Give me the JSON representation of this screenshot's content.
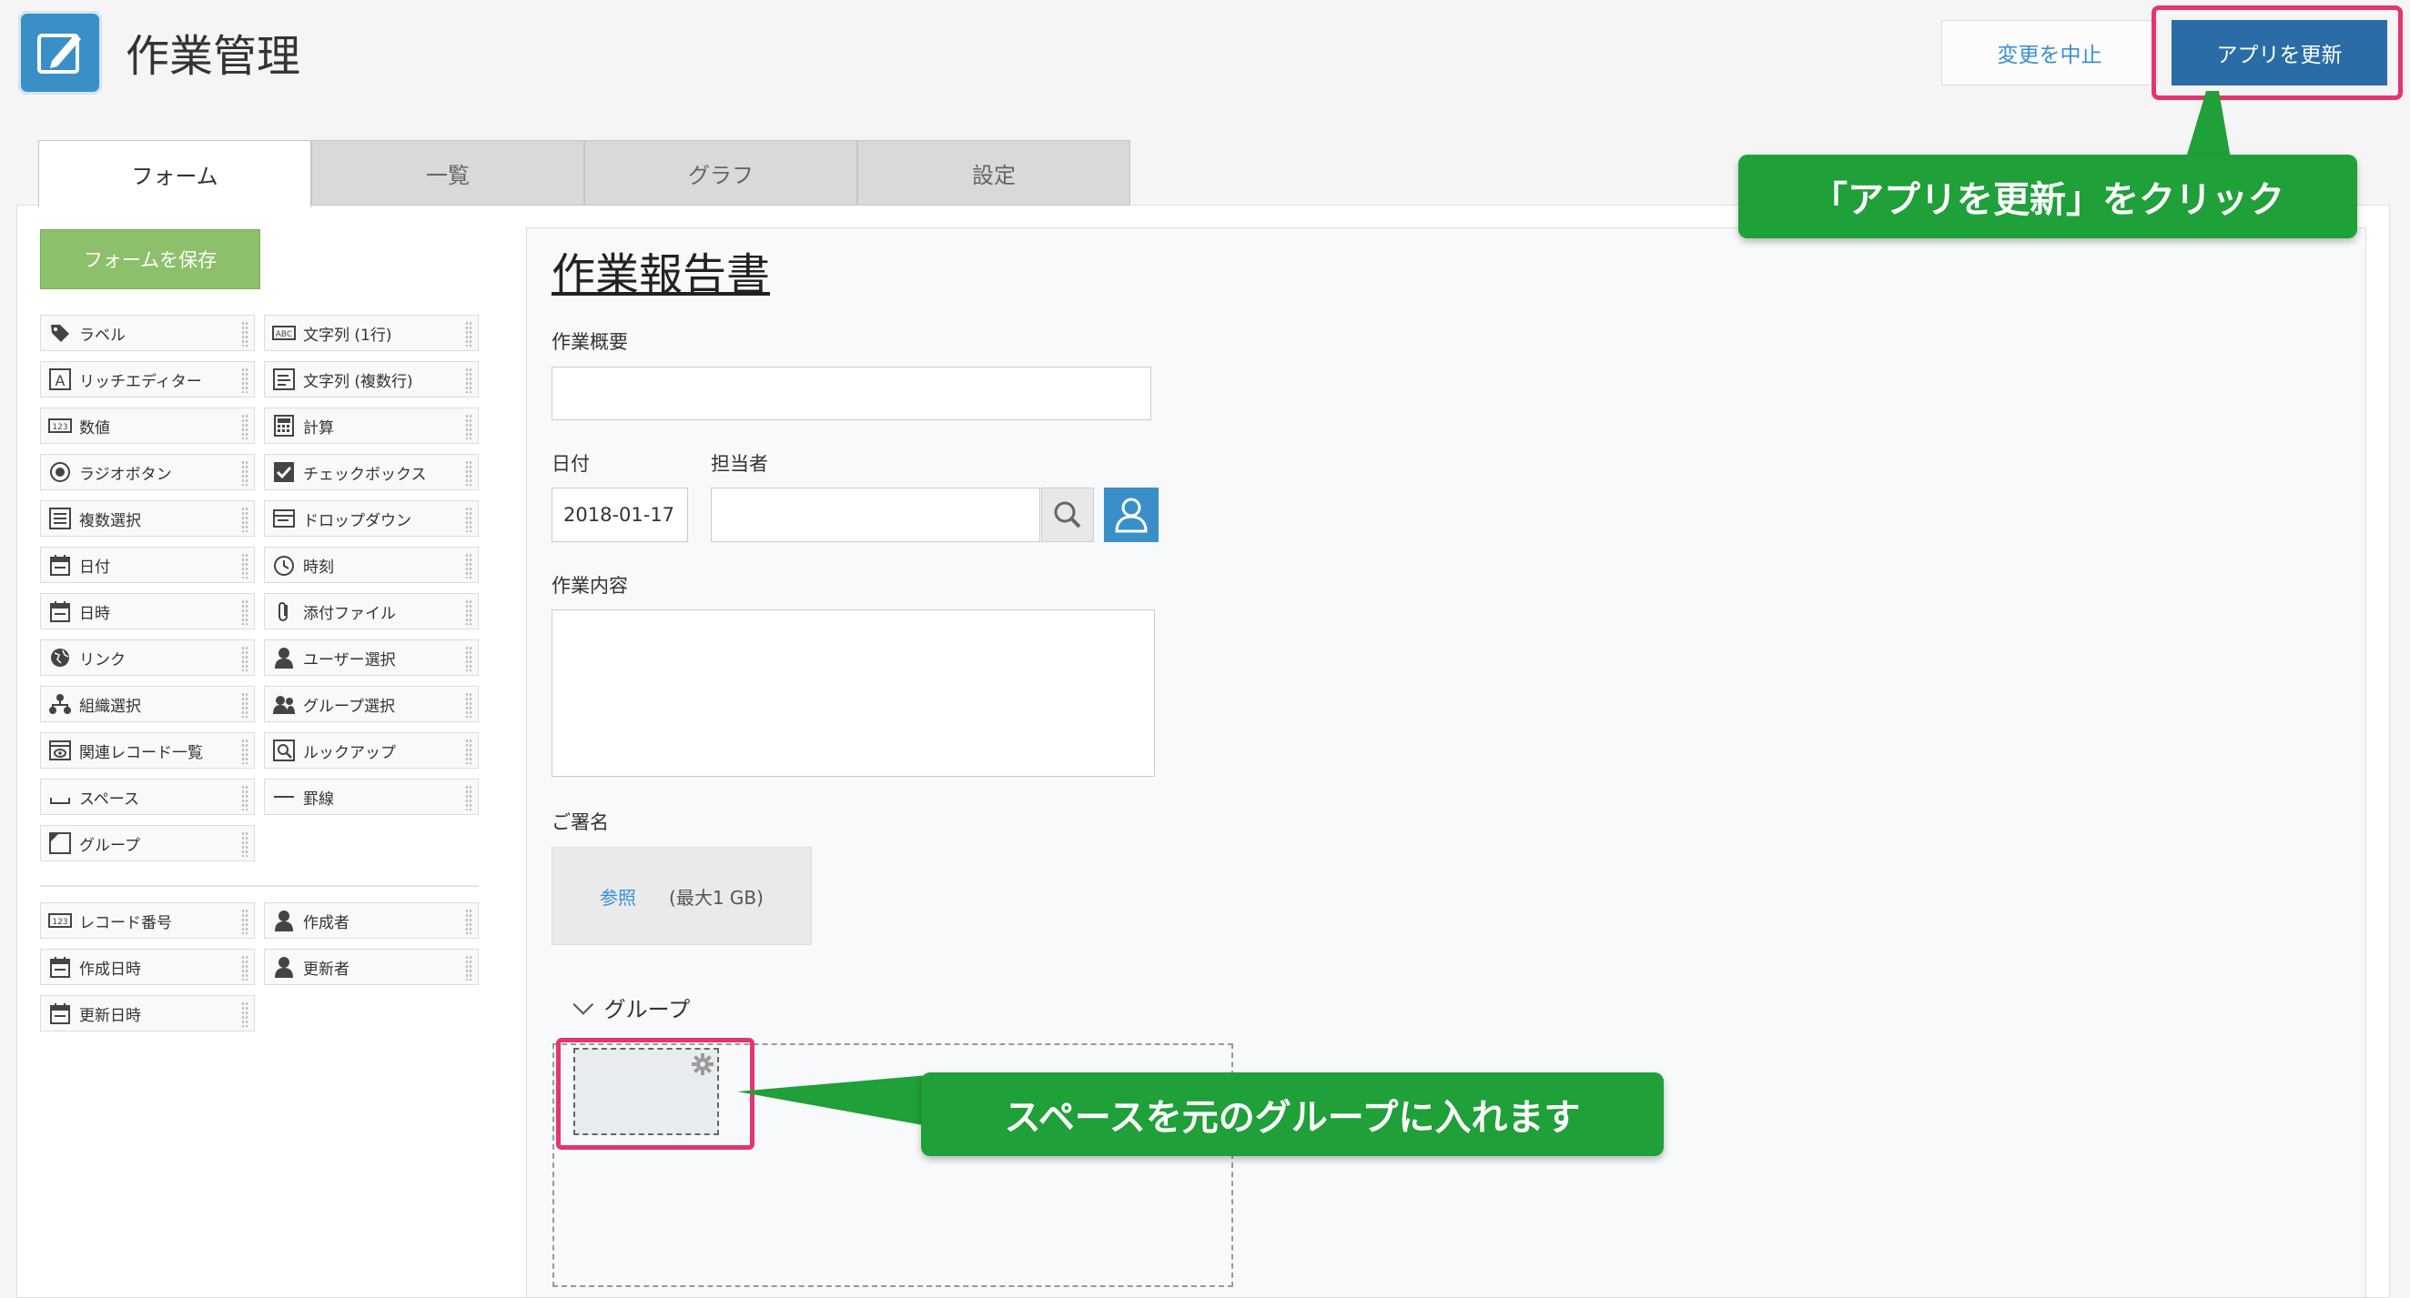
{
  "app": {
    "title": "作業管理"
  },
  "header": {
    "cancel_label": "変更を中止",
    "update_label": "アプリを更新"
  },
  "tabs": [
    {
      "label": "フォーム",
      "active": true
    },
    {
      "label": "一覧",
      "active": false
    },
    {
      "label": "グラフ",
      "active": false
    },
    {
      "label": "設定",
      "active": false
    }
  ],
  "palette": {
    "save_label": "フォームを保存",
    "items": [
      {
        "label": "ラベル",
        "icon": "tag-icon"
      },
      {
        "label": "文字列 (1行)",
        "icon": "abc-icon"
      },
      {
        "label": "リッチエディター",
        "icon": "rich-editor-icon"
      },
      {
        "label": "文字列 (複数行)",
        "icon": "multiline-text-icon"
      },
      {
        "label": "数値",
        "icon": "number-icon"
      },
      {
        "label": "計算",
        "icon": "calculator-icon"
      },
      {
        "label": "ラジオボタン",
        "icon": "radio-icon"
      },
      {
        "label": "チェックボックス",
        "icon": "checkbox-icon"
      },
      {
        "label": "複数選択",
        "icon": "multi-select-icon"
      },
      {
        "label": "ドロップダウン",
        "icon": "dropdown-icon"
      },
      {
        "label": "日付",
        "icon": "calendar-icon"
      },
      {
        "label": "時刻",
        "icon": "clock-icon"
      },
      {
        "label": "日時",
        "icon": "calendar-icon"
      },
      {
        "label": "添付ファイル",
        "icon": "paperclip-icon"
      },
      {
        "label": "リンク",
        "icon": "globe-icon"
      },
      {
        "label": "ユーザー選択",
        "icon": "user-icon"
      },
      {
        "label": "組織選択",
        "icon": "org-icon"
      },
      {
        "label": "グループ選択",
        "icon": "group-icon"
      },
      {
        "label": "関連レコード一覧",
        "icon": "related-records-icon"
      },
      {
        "label": "ルックアップ",
        "icon": "lookup-icon"
      },
      {
        "label": "スペース",
        "icon": "space-icon"
      },
      {
        "label": "罫線",
        "icon": "line-icon"
      },
      {
        "label": "グループ",
        "icon": "group-field-icon"
      }
    ],
    "system_items": [
      {
        "label": "レコード番号",
        "icon": "number-icon"
      },
      {
        "label": "作成者",
        "icon": "user-icon"
      },
      {
        "label": "作成日時",
        "icon": "calendar-icon"
      },
      {
        "label": "更新者",
        "icon": "user-icon"
      },
      {
        "label": "更新日時",
        "icon": "calendar-icon"
      }
    ]
  },
  "form": {
    "title": "作業報告書",
    "summary_label": "作業概要",
    "date_label": "日付",
    "date_value": "2018-01-17",
    "assignee_label": "担当者",
    "content_label": "作業内容",
    "signature_label": "ご署名",
    "browse_label": "参照",
    "max_size": "(最大1 GB)",
    "group_label": "グループ"
  },
  "callouts": {
    "update": "「アプリを更新」をクリック",
    "space": "スペースを元のグループに入れます"
  },
  "colors": {
    "accent": "#2a6da6",
    "callout": "#1fa038",
    "highlight": "#e5356e",
    "save": "#8cc06a"
  }
}
